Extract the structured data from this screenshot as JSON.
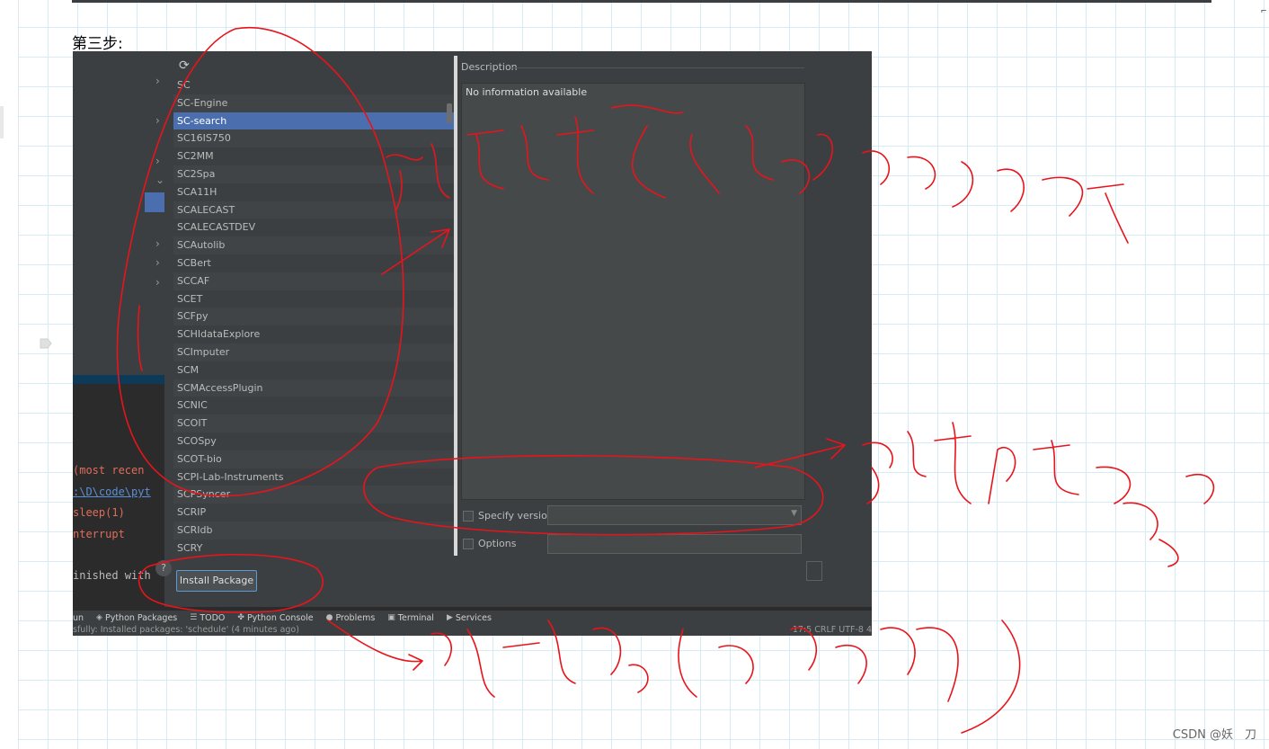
{
  "doc": {
    "step_label": "第三步:",
    "watermark": "CSDN @妖　刀"
  },
  "dialog": {
    "packages": [
      "SC",
      "SC-Engine",
      "SC-search",
      "SC16IS750",
      "SC2MM",
      "SC2Spa",
      "SCA11H",
      "SCALECAST",
      "SCALECASTDEV",
      "SCAutolib",
      "SCBert",
      "SCCAF",
      "SCET",
      "SCFpy",
      "SCHIdataExplore",
      "SCImputer",
      "SCM",
      "SCMAccessPlugin",
      "SCNIC",
      "SCOIT",
      "SCOSpy",
      "SCOT-bio",
      "SCPI-Lab-Instruments",
      "SCPSyncer",
      "SCRIP",
      "SCRIdb",
      "SCRY"
    ],
    "selected_package": "SC-search",
    "description_label": "Description",
    "description_text": "No information available",
    "specify_version_label": "Specify version",
    "options_label": "Options",
    "install_button": "Install Package",
    "help_icon": "question-icon",
    "refresh_icon": "refresh-icon"
  },
  "console": {
    "line1": "(most recen",
    "line2": ":\\D\\code\\pyt",
    "line3": "sleep(1)",
    "line4": "nterrupt",
    "line5": "inished with"
  },
  "toolbar": {
    "run": "un",
    "python_packages": "Python Packages",
    "todo": "TODO",
    "python_console": "Python Console",
    "problems": "Problems",
    "terminal": "Terminal",
    "services": "Services"
  },
  "status": {
    "message": "sfully: Installed packages: 'schedule' (4 minutes ago)",
    "right": "17:5   CRLF   UTF-8   4"
  },
  "colors": {
    "ide_bg": "#2b2b2b",
    "panel": "#3c3f41",
    "selection": "#4b6eaf",
    "annotation": "#e8141b"
  }
}
